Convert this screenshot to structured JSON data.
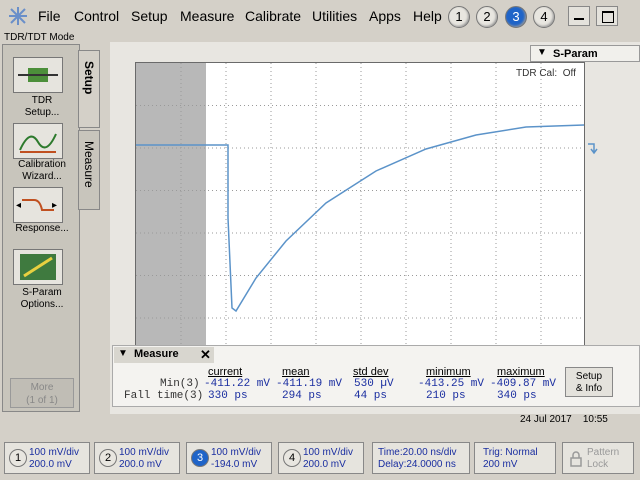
{
  "menubar": {
    "items": [
      "File",
      "Control",
      "Setup",
      "Measure",
      "Calibrate",
      "Utilities",
      "Apps",
      "Help"
    ],
    "channels": [
      "1",
      "2",
      "3",
      "4"
    ],
    "active_channel": "3"
  },
  "mode": "TDR/TDT Mode",
  "left_panel": {
    "tabs": [
      "Setup",
      "Measure"
    ],
    "buttons": [
      {
        "label": "TDR\nSetup..."
      },
      {
        "label": "Calibration\nWizard..."
      },
      {
        "label": "Response..."
      },
      {
        "label": "S-Param\nOptions..."
      }
    ],
    "more": "More\n(1 of 1)"
  },
  "scope": {
    "sparam_tab": "S-Param",
    "tdr_cal_label": "TDR Cal:",
    "tdr_cal_value": "Off",
    "trace_color": "#5b93c9"
  },
  "measure": {
    "title": "Measure",
    "headers": [
      "current",
      "mean",
      "std dev",
      "minimum",
      "maximum"
    ],
    "rows": [
      {
        "label": "Min(3)",
        "values": [
          "-411.22 mV",
          "-411.19 mV",
          "530 µV",
          "-413.25 mV",
          "-409.87 mV"
        ]
      },
      {
        "label": "Fall time(3)",
        "values": [
          "330 ps",
          "294 ps",
          "44 ps",
          "210 ps",
          "340 ps"
        ]
      }
    ],
    "setup_info": "Setup\n& Info"
  },
  "datetime": {
    "date": "24 Jul 2017",
    "time": "10:55"
  },
  "bottom": {
    "channels": [
      {
        "num": "1",
        "line1": "100 mV/div",
        "line2": "200.0 mV"
      },
      {
        "num": "2",
        "line1": "100 mV/div",
        "line2": "200.0 mV"
      },
      {
        "num": "3",
        "line1": "100 mV/div",
        "line2": "-194.0 mV"
      },
      {
        "num": "4",
        "line1": "100 mV/div",
        "line2": "200.0 mV"
      }
    ],
    "time": {
      "line1": "Time:20.00 ns/div",
      "line2": "Delay:24.0000 ns"
    },
    "trig": {
      "line1": "Trig: Normal",
      "line2": "200 mV"
    },
    "pattern": {
      "line1": "Pattern",
      "line2": "Lock"
    }
  }
}
